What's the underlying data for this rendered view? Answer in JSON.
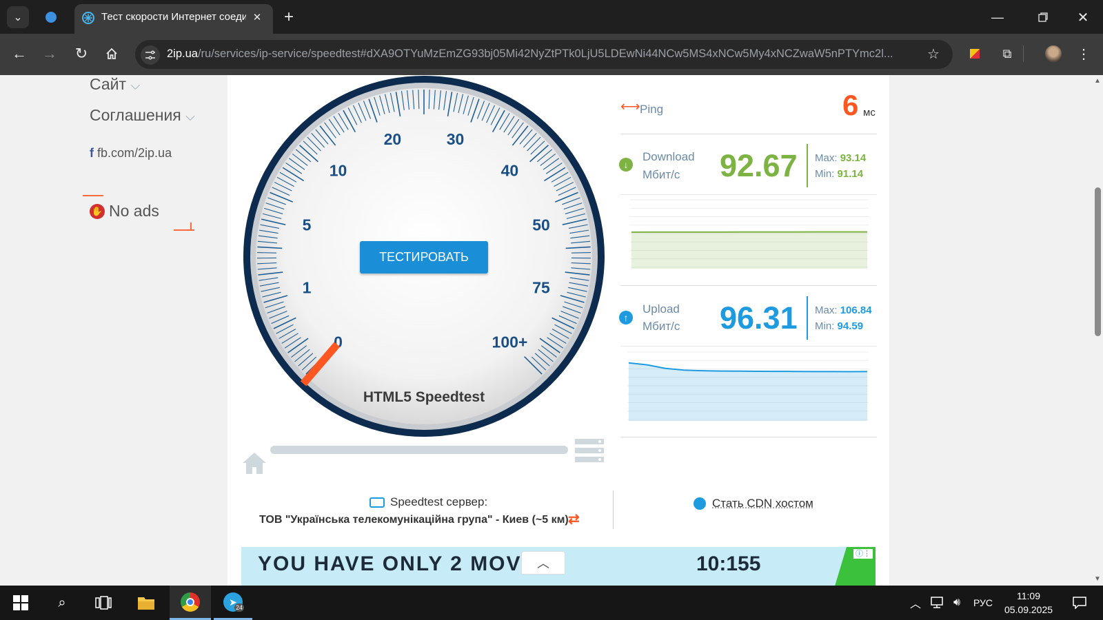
{
  "browser": {
    "tab_title": "Тест скорости Интернет соедин",
    "url_host": "2ip.ua",
    "url_path": "/ru/services/ip-service/speedtest#dXA9OTYuMzEmZG93bj05Mi42NyZtPTk0LjU5LDEwNi44NCw5MS4xNCw5My4xNCZwaW5nPTYmc2l..."
  },
  "sidebar": {
    "site_label": "Сайт",
    "agreements_label": "Соглашения",
    "fb_label": "fb.com/2ip.ua",
    "noads_label": "No ads"
  },
  "gauge": {
    "labels": [
      "0",
      "1",
      "5",
      "10",
      "20",
      "30",
      "40",
      "50",
      "75",
      "100+"
    ],
    "button_label": "ТЕСТИРОВАТЬ",
    "caption": "HTML5 Speedtest"
  },
  "ping": {
    "label": "Ping",
    "value": "6",
    "unit": "мс"
  },
  "download": {
    "label": "Download",
    "unit": "Мбит/с",
    "value": "92.67",
    "max_label": "Max:",
    "max": "93.14",
    "min_label": "Min:",
    "min": "91.14",
    "chart": [
      91.9,
      92.0,
      92.1,
      92.2,
      92.1,
      92.2,
      92.3,
      92.4,
      92.3,
      92.4,
      92.5,
      92.6,
      92.6,
      92.67
    ]
  },
  "upload": {
    "label": "Upload",
    "unit": "Мбит/с",
    "value": "96.31",
    "max_label": "Max:",
    "max": "106.84",
    "min_label": "Min:",
    "min": "94.59",
    "chart": [
      106.84,
      104.5,
      100.2,
      98.1,
      97.4,
      97.0,
      96.9,
      96.7,
      96.6,
      96.5,
      96.4,
      96.4,
      96.3,
      96.31
    ]
  },
  "server": {
    "label": "Speedtest сервер:",
    "name": "ТОВ \"Українська телекомунікаційна група\" - Киев (~5 км)",
    "cdn_label": "Стать CDN хостом"
  },
  "ad": {
    "text": "YOU HAVE ONLY 2 MOVES",
    "score": "10:155"
  },
  "taskbar": {
    "lang": "РУС",
    "time": "11:09",
    "date": "05.09.2025",
    "telegram_badge": "24"
  },
  "colors": {
    "green": "#7cb342",
    "blue": "#1e9be0",
    "orange": "#ff5722",
    "navy": "#0d2b4e",
    "button": "#1a8fd8"
  }
}
